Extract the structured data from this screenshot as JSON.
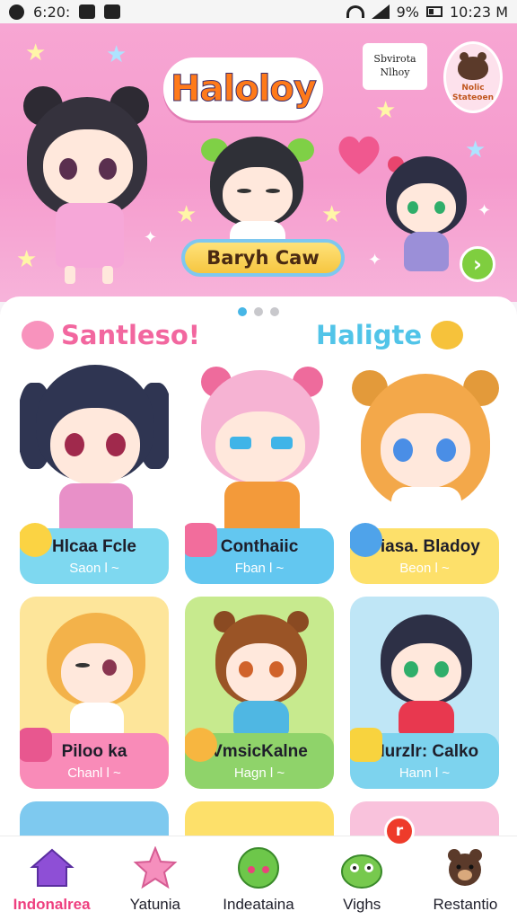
{
  "status_bar": {
    "time": "6:20:",
    "battery": "9%",
    "clock": "10:23 M"
  },
  "banner": {
    "logo_text": "Haloloy",
    "promo_box_line1": "Sbvirota",
    "promo_box_line2": "Nlhoy",
    "badge_line1": "Nolic",
    "badge_line2": "Stateoen",
    "cta_label": "Baryh Caw",
    "next_icon": "chevron-right-icon",
    "carousel_dots": 3,
    "carousel_active": 0
  },
  "sections": {
    "left_title": "Santleso!",
    "right_title": "Haligte"
  },
  "cards": [
    {
      "name": "Hlcaa Fcle",
      "sub": "Saon l ~",
      "label_color": "#7ed8f0"
    },
    {
      "name": "Conthaiic",
      "sub": "Fban l ~",
      "label_color": "#63c7f0"
    },
    {
      "name": "Piasa. Bladoy",
      "sub": "Beon l ~",
      "label_color": "#fde06a"
    },
    {
      "name": "Piloo ka",
      "sub": "Chanl l ~",
      "label_color": "#f98bb8"
    },
    {
      "name": "VmsicKalne",
      "sub": "Hagn l ~",
      "label_color": "#8fd36a"
    },
    {
      "name": "Murzlr: Calko",
      "sub": "Hann l ~",
      "label_color": "#7dd3ee"
    }
  ],
  "bottom_nav": {
    "items": [
      {
        "label": "Indonalrea",
        "icon": "home-icon",
        "active": true
      },
      {
        "label": "Yatunia",
        "icon": "star-icon",
        "active": false
      },
      {
        "label": "Indeataina",
        "icon": "green-blob-icon",
        "active": false
      },
      {
        "label": "Vighs",
        "icon": "green-creature-icon",
        "active": false
      },
      {
        "label": "Restantio",
        "icon": "bear-icon",
        "active": false
      }
    ],
    "notification_label": "r"
  }
}
